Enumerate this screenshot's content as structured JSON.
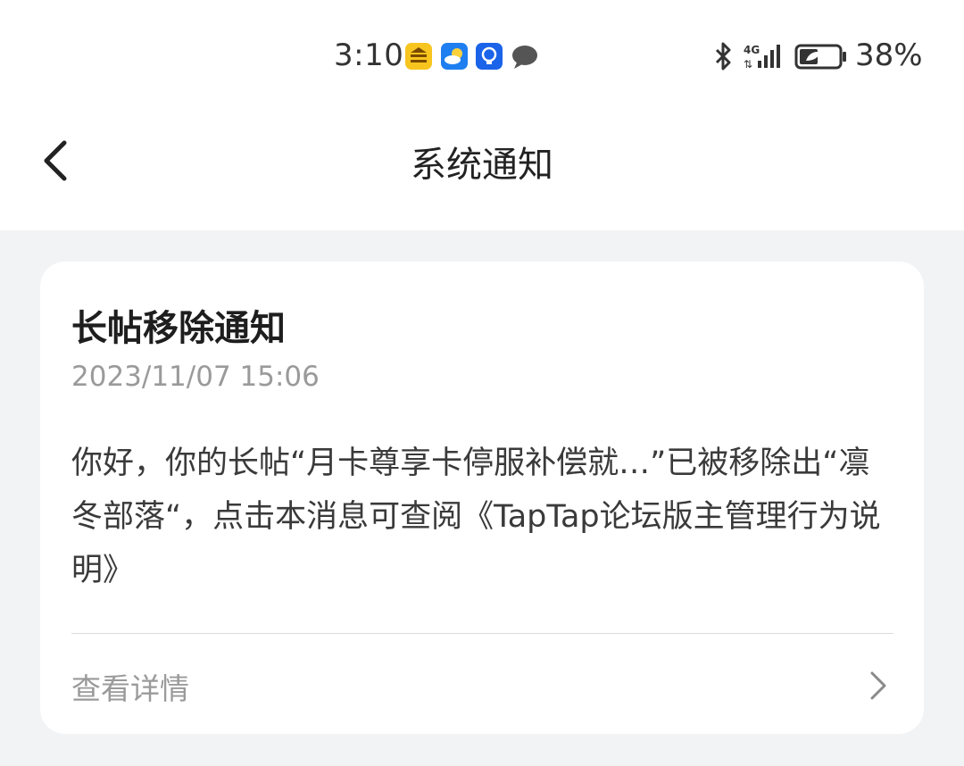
{
  "status_bar": {
    "time": "3:10",
    "battery_percent": "38%",
    "network": "4G",
    "icons": [
      "meituan-app-icon",
      "weather-app-icon",
      "bulb-app-icon",
      "chat-bubble-icon",
      "bluetooth-icon",
      "signal-icon",
      "battery-icon"
    ]
  },
  "header": {
    "title": "系统通知"
  },
  "notification": {
    "title": "长帖移除通知",
    "timestamp": "2023/11/07 15:06",
    "body": "你好，你的长帖“月卡尊享卡停服补偿就…”已被移除出“凛冬部落“，点击本消息可查阅《TapTap论坛版主管理行为说明》",
    "details_label": "查看详情"
  },
  "colors": {
    "page_background": "#f2f3f5",
    "card_background": "#ffffff",
    "secondary_text": "#9a9a9a",
    "meituan_yellow": "#f7c51e",
    "app_blue": "#1b63e8"
  }
}
